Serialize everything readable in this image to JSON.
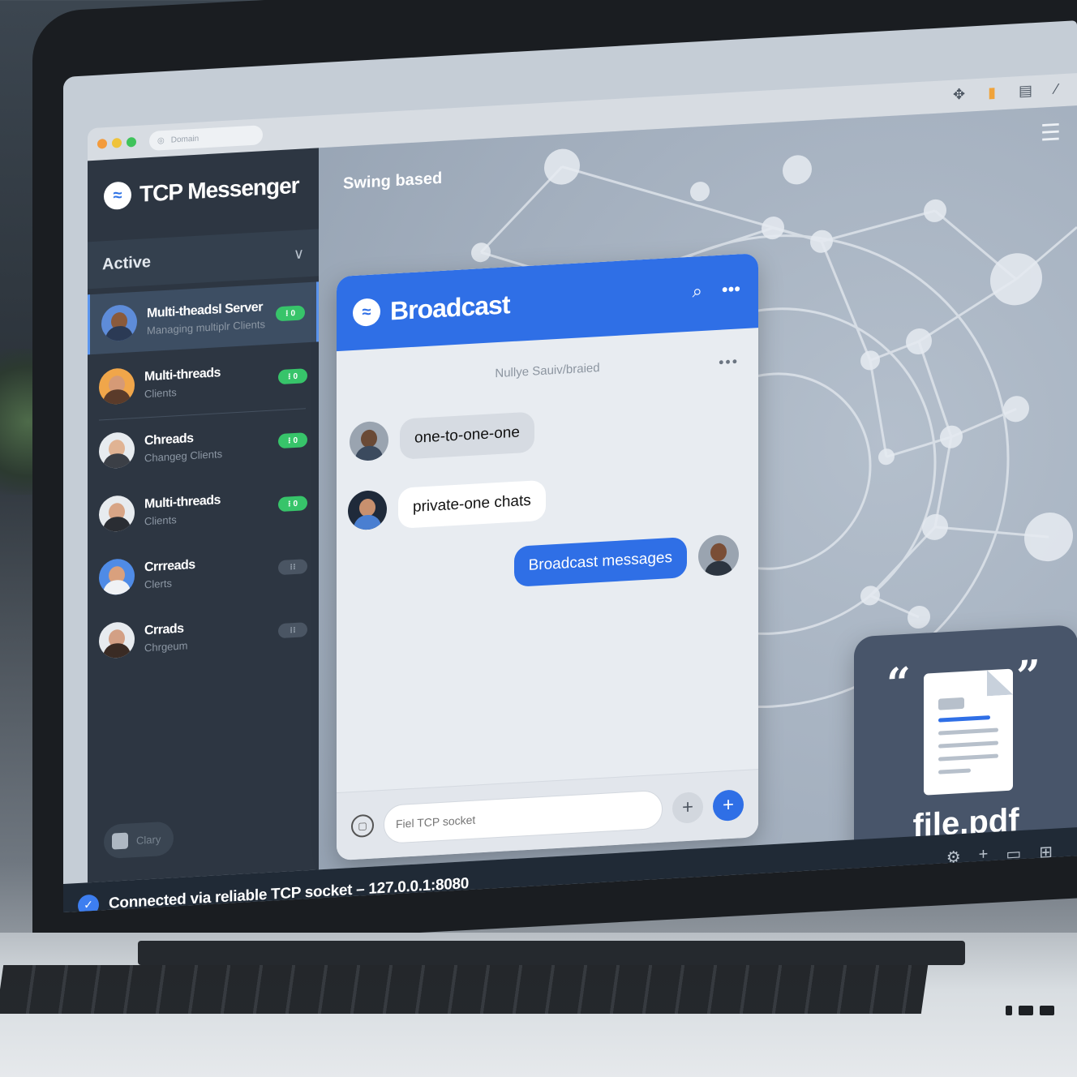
{
  "app": {
    "title": "TCP Messenger",
    "url_placeholder": "Domain"
  },
  "topbar": {
    "icons": [
      "pin-icon",
      "flag-icon",
      "window-icon",
      "edit-icon"
    ]
  },
  "sidebar": {
    "section_label": "Active",
    "contacts": [
      {
        "name": "Multi-theadsl Server",
        "subtitle": "Managing multiplr Clients",
        "badge": "⁝ 0",
        "status": "online"
      },
      {
        "name": "Multi-threads",
        "subtitle": "Clients",
        "badge": "⁝ 0",
        "status": "online"
      },
      {
        "name": "Chreads",
        "subtitle": "Changeg Clients",
        "badge": "⁝ 0",
        "status": "online"
      },
      {
        "name": "Multi-threads",
        "subtitle": "Clients",
        "badge": "⁝ 0",
        "status": "online"
      },
      {
        "name": "Crrreads",
        "subtitle": "Clerts",
        "badge": "⁝⁝",
        "status": "offline"
      },
      {
        "name": "Crrads",
        "subtitle": "Chrgeum",
        "badge": "⁝⁝",
        "status": "offline"
      }
    ],
    "bottom_button": "Clary"
  },
  "main": {
    "header_label": "Swing based"
  },
  "chat": {
    "title": "Broadcast",
    "subtitle": "Nullye Sauiv/braied",
    "messages": [
      {
        "text": "one-to-one-one",
        "side": "left",
        "style": "grey"
      },
      {
        "text": "private-one chats",
        "side": "left",
        "style": "white"
      },
      {
        "text": "Broadcast messages",
        "side": "right",
        "style": "blue"
      }
    ],
    "input_placeholder": "Fiel TCP socket"
  },
  "file": {
    "name": "file.pdf",
    "open_quote": "“",
    "close_quote": "”"
  },
  "status": {
    "text": "Connected via reliable TCP socket – 127.0.0.1:8080"
  },
  "colors": {
    "accent": "#2f6fe6",
    "sidebar_bg": "#2d3642",
    "online_badge": "#37c46a"
  }
}
